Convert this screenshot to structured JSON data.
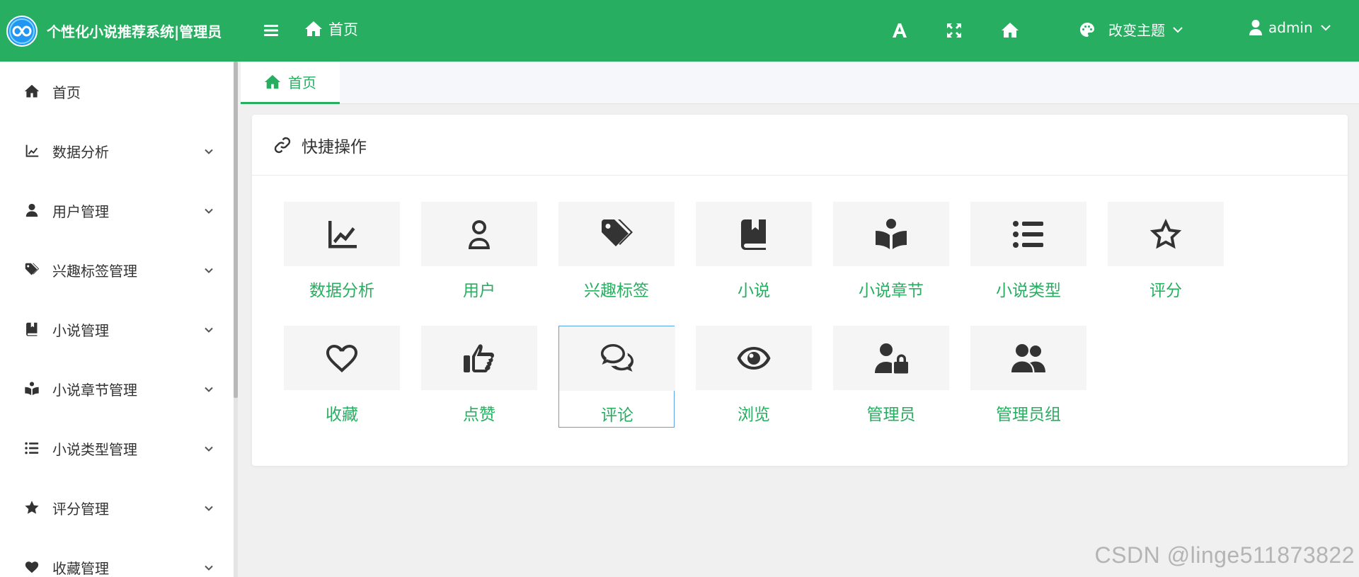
{
  "app": {
    "title": "个性化小说推荐系统|管理员",
    "brand_color": "#27ae60"
  },
  "header": {
    "home_label": "首页",
    "tools": [
      "font-size-icon",
      "fullscreen-icon",
      "home-icon"
    ],
    "theme_label": "改变主题",
    "user_label": "admin"
  },
  "sidebar": {
    "items": [
      {
        "label": "首页",
        "icon": "home-icon",
        "expandable": false
      },
      {
        "label": "数据分析",
        "icon": "chart-line-icon",
        "expandable": true
      },
      {
        "label": "用户管理",
        "icon": "user-icon",
        "expandable": true
      },
      {
        "label": "兴趣标签管理",
        "icon": "tags-icon",
        "expandable": true
      },
      {
        "label": "小说管理",
        "icon": "book-icon",
        "expandable": true
      },
      {
        "label": "小说章节管理",
        "icon": "book-reader-icon",
        "expandable": true
      },
      {
        "label": "小说类型管理",
        "icon": "list-icon",
        "expandable": true
      },
      {
        "label": "评分管理",
        "icon": "star-icon",
        "expandable": true
      },
      {
        "label": "收藏管理",
        "icon": "heart-icon",
        "expandable": true
      }
    ]
  },
  "tabs": [
    {
      "label": "首页",
      "icon": "home-icon",
      "active": true
    }
  ],
  "quick": {
    "title": "快捷操作",
    "items": [
      {
        "label": "数据分析",
        "icon": "chart-line-icon"
      },
      {
        "label": "用户",
        "icon": "user-outline-icon"
      },
      {
        "label": "兴趣标签",
        "icon": "tags-icon"
      },
      {
        "label": "小说",
        "icon": "book-icon"
      },
      {
        "label": "小说章节",
        "icon": "book-reader-icon"
      },
      {
        "label": "小说类型",
        "icon": "list-icon"
      },
      {
        "label": "评分",
        "icon": "star-outline-icon"
      },
      {
        "label": "收藏",
        "icon": "heart-outline-icon"
      },
      {
        "label": "点赞",
        "icon": "thumbs-up-icon"
      },
      {
        "label": "评论",
        "icon": "comments-icon",
        "selected": true
      },
      {
        "label": "浏览",
        "icon": "eye-icon"
      },
      {
        "label": "管理员",
        "icon": "user-lock-icon"
      },
      {
        "label": "管理员组",
        "icon": "users-icon"
      }
    ]
  },
  "watermark": "CSDN @linge511873822"
}
